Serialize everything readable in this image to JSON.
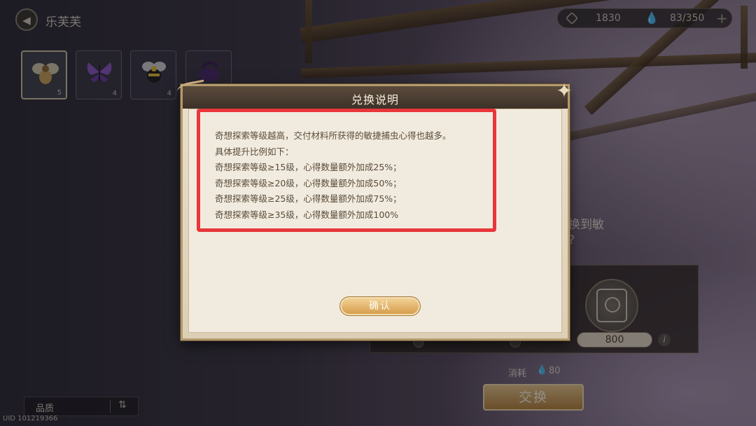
{
  "header": {
    "back_icon": "back-arrow-icon",
    "npc_name": "乐芙芙"
  },
  "resources": {
    "currency_icon": "emblem-icon",
    "currency_value": "1830",
    "energy_icon": "water-drop-icon",
    "energy_value": "83/350",
    "add_icon": "plus-icon"
  },
  "materials": [
    {
      "name": "yellow-bee-item",
      "count": "5",
      "selected": true
    },
    {
      "name": "purple-butterfly-item",
      "count": "4",
      "selected": false
    },
    {
      "name": "black-yellow-bee-item",
      "count": "4",
      "selected": false
    },
    {
      "name": "purple-beetle-item",
      "count": "",
      "selected": false
    }
  ],
  "side_panel": {
    "text_line1": "换到敏",
    "text_line2": "?",
    "amount": "800",
    "info_icon": "info-icon",
    "cost_label": "消耗",
    "cost_icon": "water-drop-icon",
    "cost_value": "80",
    "exchange_label": "交换"
  },
  "filter": {
    "label": "品质",
    "sort_icon": "sort-arrows-icon"
  },
  "footer": {
    "uid": "UID 101219366"
  },
  "dialog": {
    "title": "兑换说明",
    "lines": [
      "奇想探索等级越高，交付材料所获得的敏捷捕虫心得也越多。",
      "具体提升比例如下：",
      "奇想探索等级≥15级，心得数量额外加成25%；",
      "奇想探索等级≥20级，心得数量额外加成50%；",
      "奇想探索等级≥25级，心得数量额外加成75%；",
      "奇想探索等级≥35级，心得数量额外加成100%"
    ],
    "confirm_label": "确认"
  },
  "colors": {
    "highlight": "#e8363a",
    "button_gold": "#d49a48",
    "parchment": "#f1ebdf"
  }
}
